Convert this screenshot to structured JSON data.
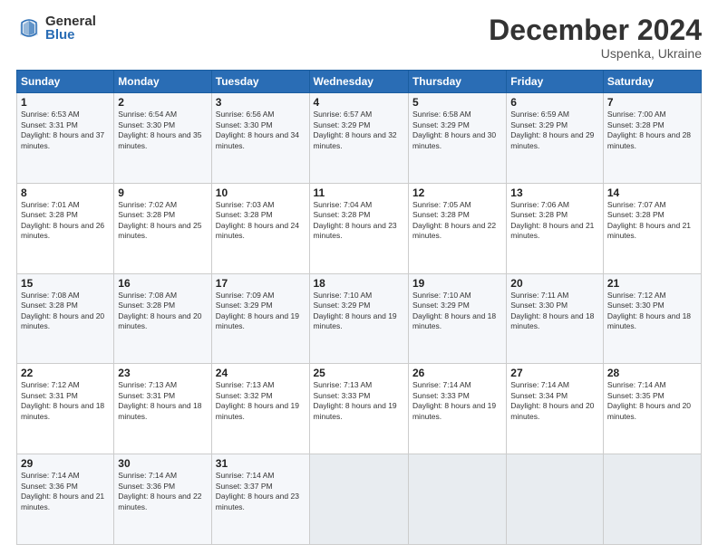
{
  "header": {
    "logo_general": "General",
    "logo_blue": "Blue",
    "month_title": "December 2024",
    "subtitle": "Uspenka, Ukraine"
  },
  "weekdays": [
    "Sunday",
    "Monday",
    "Tuesday",
    "Wednesday",
    "Thursday",
    "Friday",
    "Saturday"
  ],
  "weeks": [
    [
      {
        "day": "1",
        "sunrise": "Sunrise: 6:53 AM",
        "sunset": "Sunset: 3:31 PM",
        "daylight": "Daylight: 8 hours and 37 minutes."
      },
      {
        "day": "2",
        "sunrise": "Sunrise: 6:54 AM",
        "sunset": "Sunset: 3:30 PM",
        "daylight": "Daylight: 8 hours and 35 minutes."
      },
      {
        "day": "3",
        "sunrise": "Sunrise: 6:56 AM",
        "sunset": "Sunset: 3:30 PM",
        "daylight": "Daylight: 8 hours and 34 minutes."
      },
      {
        "day": "4",
        "sunrise": "Sunrise: 6:57 AM",
        "sunset": "Sunset: 3:29 PM",
        "daylight": "Daylight: 8 hours and 32 minutes."
      },
      {
        "day": "5",
        "sunrise": "Sunrise: 6:58 AM",
        "sunset": "Sunset: 3:29 PM",
        "daylight": "Daylight: 8 hours and 30 minutes."
      },
      {
        "day": "6",
        "sunrise": "Sunrise: 6:59 AM",
        "sunset": "Sunset: 3:29 PM",
        "daylight": "Daylight: 8 hours and 29 minutes."
      },
      {
        "day": "7",
        "sunrise": "Sunrise: 7:00 AM",
        "sunset": "Sunset: 3:28 PM",
        "daylight": "Daylight: 8 hours and 28 minutes."
      }
    ],
    [
      {
        "day": "8",
        "sunrise": "Sunrise: 7:01 AM",
        "sunset": "Sunset: 3:28 PM",
        "daylight": "Daylight: 8 hours and 26 minutes."
      },
      {
        "day": "9",
        "sunrise": "Sunrise: 7:02 AM",
        "sunset": "Sunset: 3:28 PM",
        "daylight": "Daylight: 8 hours and 25 minutes."
      },
      {
        "day": "10",
        "sunrise": "Sunrise: 7:03 AM",
        "sunset": "Sunset: 3:28 PM",
        "daylight": "Daylight: 8 hours and 24 minutes."
      },
      {
        "day": "11",
        "sunrise": "Sunrise: 7:04 AM",
        "sunset": "Sunset: 3:28 PM",
        "daylight": "Daylight: 8 hours and 23 minutes."
      },
      {
        "day": "12",
        "sunrise": "Sunrise: 7:05 AM",
        "sunset": "Sunset: 3:28 PM",
        "daylight": "Daylight: 8 hours and 22 minutes."
      },
      {
        "day": "13",
        "sunrise": "Sunrise: 7:06 AM",
        "sunset": "Sunset: 3:28 PM",
        "daylight": "Daylight: 8 hours and 21 minutes."
      },
      {
        "day": "14",
        "sunrise": "Sunrise: 7:07 AM",
        "sunset": "Sunset: 3:28 PM",
        "daylight": "Daylight: 8 hours and 21 minutes."
      }
    ],
    [
      {
        "day": "15",
        "sunrise": "Sunrise: 7:08 AM",
        "sunset": "Sunset: 3:28 PM",
        "daylight": "Daylight: 8 hours and 20 minutes."
      },
      {
        "day": "16",
        "sunrise": "Sunrise: 7:08 AM",
        "sunset": "Sunset: 3:28 PM",
        "daylight": "Daylight: 8 hours and 20 minutes."
      },
      {
        "day": "17",
        "sunrise": "Sunrise: 7:09 AM",
        "sunset": "Sunset: 3:29 PM",
        "daylight": "Daylight: 8 hours and 19 minutes."
      },
      {
        "day": "18",
        "sunrise": "Sunrise: 7:10 AM",
        "sunset": "Sunset: 3:29 PM",
        "daylight": "Daylight: 8 hours and 19 minutes."
      },
      {
        "day": "19",
        "sunrise": "Sunrise: 7:10 AM",
        "sunset": "Sunset: 3:29 PM",
        "daylight": "Daylight: 8 hours and 18 minutes."
      },
      {
        "day": "20",
        "sunrise": "Sunrise: 7:11 AM",
        "sunset": "Sunset: 3:30 PM",
        "daylight": "Daylight: 8 hours and 18 minutes."
      },
      {
        "day": "21",
        "sunrise": "Sunrise: 7:12 AM",
        "sunset": "Sunset: 3:30 PM",
        "daylight": "Daylight: 8 hours and 18 minutes."
      }
    ],
    [
      {
        "day": "22",
        "sunrise": "Sunrise: 7:12 AM",
        "sunset": "Sunset: 3:31 PM",
        "daylight": "Daylight: 8 hours and 18 minutes."
      },
      {
        "day": "23",
        "sunrise": "Sunrise: 7:13 AM",
        "sunset": "Sunset: 3:31 PM",
        "daylight": "Daylight: 8 hours and 18 minutes."
      },
      {
        "day": "24",
        "sunrise": "Sunrise: 7:13 AM",
        "sunset": "Sunset: 3:32 PM",
        "daylight": "Daylight: 8 hours and 19 minutes."
      },
      {
        "day": "25",
        "sunrise": "Sunrise: 7:13 AM",
        "sunset": "Sunset: 3:33 PM",
        "daylight": "Daylight: 8 hours and 19 minutes."
      },
      {
        "day": "26",
        "sunrise": "Sunrise: 7:14 AM",
        "sunset": "Sunset: 3:33 PM",
        "daylight": "Daylight: 8 hours and 19 minutes."
      },
      {
        "day": "27",
        "sunrise": "Sunrise: 7:14 AM",
        "sunset": "Sunset: 3:34 PM",
        "daylight": "Daylight: 8 hours and 20 minutes."
      },
      {
        "day": "28",
        "sunrise": "Sunrise: 7:14 AM",
        "sunset": "Sunset: 3:35 PM",
        "daylight": "Daylight: 8 hours and 20 minutes."
      }
    ],
    [
      {
        "day": "29",
        "sunrise": "Sunrise: 7:14 AM",
        "sunset": "Sunset: 3:36 PM",
        "daylight": "Daylight: 8 hours and 21 minutes."
      },
      {
        "day": "30",
        "sunrise": "Sunrise: 7:14 AM",
        "sunset": "Sunset: 3:36 PM",
        "daylight": "Daylight: 8 hours and 22 minutes."
      },
      {
        "day": "31",
        "sunrise": "Sunrise: 7:14 AM",
        "sunset": "Sunset: 3:37 PM",
        "daylight": "Daylight: 8 hours and 23 minutes."
      },
      null,
      null,
      null,
      null
    ]
  ]
}
